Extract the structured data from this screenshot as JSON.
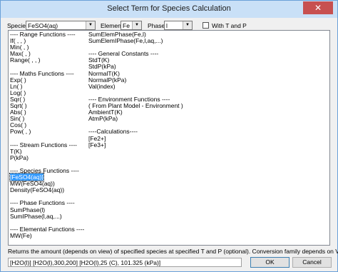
{
  "window": {
    "title": "Select Term for Species Calculation",
    "close_glyph": "✕"
  },
  "toolbar": {
    "species_label": "Species",
    "species_value": "FeSO4(aq)",
    "element_label": "Element",
    "element_value": "Fe",
    "phase_label": "Phase",
    "phase_value": "l",
    "with_t_and_p_label": "With T and P",
    "with_t_and_p_checked": false
  },
  "list": {
    "column1": [
      "---- Range Functions ----",
      "If( , , )",
      "Min( , )",
      "Max( , )",
      "Range( , , )",
      "",
      "---- Maths Functions ----",
      "Exp( )",
      "Ln( )",
      "Log( )",
      "Sqr( )",
      "Sqrt( )",
      "Abs( )",
      "Sin( )",
      "Cos( )",
      "Pow( , )",
      "",
      "---- Stream Functions ----",
      "T(K)",
      "P(kPa)",
      "",
      "---- Species Functions ----",
      "[FeSO4(aq)]",
      "MW(FeSO4(aq))",
      "Density(FeSO4(aq))",
      "",
      "---- Phase Functions ----",
      "SumPhase(l)",
      "SumIPhase(l,aq,...)",
      "",
      "---- Elemental Functions ----",
      "MW(Fe)"
    ],
    "column2": [
      "SumElemPhase(Fe,l)",
      "SumElemIPhase(Fe,l,aq,...)",
      "",
      "---- General Constants ----",
      "StdT(K)",
      "StdP(kPa)",
      "NormalT(K)",
      "NormalP(kPa)",
      "Val(index)",
      "",
      "---- Environment Functions ----",
      "( From Plant Model - Environment )",
      "AmbientT(K)",
      "AtmP(kPa)",
      "",
      "----Calculations----",
      "[Fe2+]",
      "[Fe3+]"
    ],
    "selected_item": "[FeSO4(aq)]"
  },
  "description": "Returns the amount (depends on view) of specified species at specified T and P (optional). Conversion family depends on View.",
  "status_text": "[H2O(l)]     [H2O(l),300,200]     [H2O(l),25 (C), 101.325 (kPa)]",
  "buttons": {
    "ok": "OK",
    "cancel": "Cancel"
  }
}
